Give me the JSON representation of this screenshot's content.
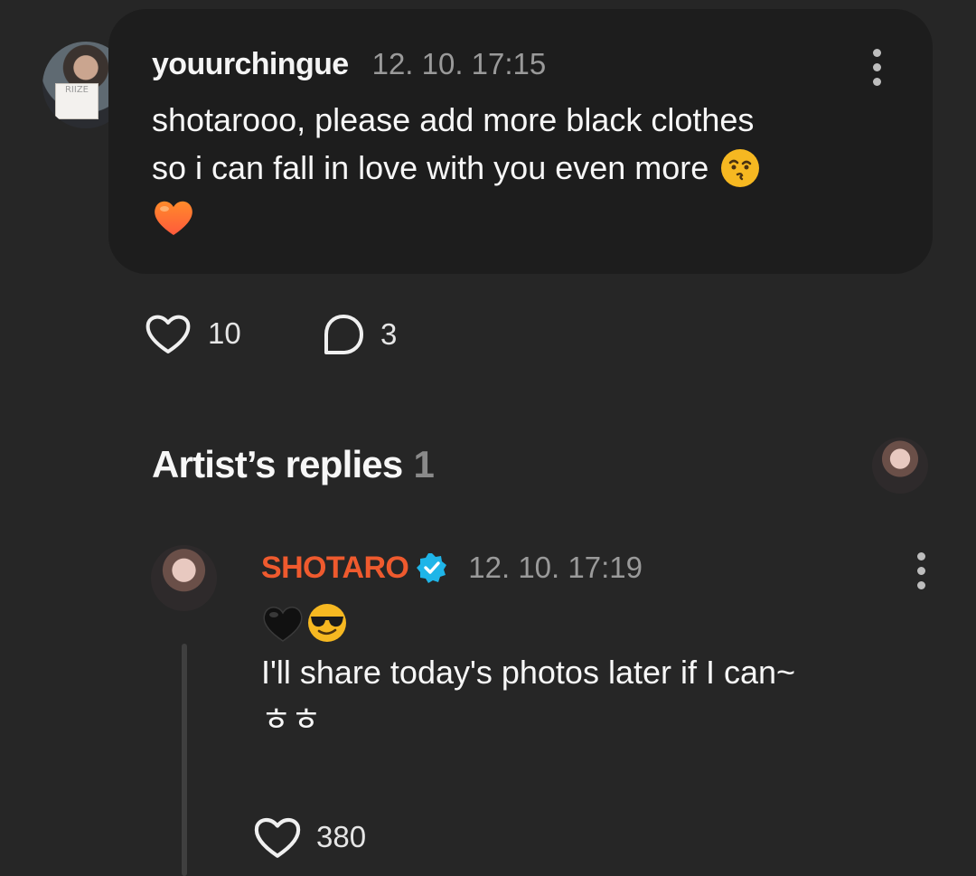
{
  "comment": {
    "username": "youurchingue",
    "timestamp": "12. 10. 17:15",
    "avatar_sign_text": "RIIZE",
    "text_line1": "shotarooo, please add more black clothes",
    "text_line2": "so i can fall in love with you even more",
    "emoji_1": "kissing-face-icon",
    "emoji_2": "orange-heart-icon",
    "likes": "10",
    "replies": "3"
  },
  "artist_replies": {
    "title": "Artist’s replies",
    "count": "1"
  },
  "reply": {
    "username": "SHOTARO",
    "verified_icon": "verified-badge-icon",
    "timestamp": "12. 10. 17:19",
    "emoji_1": "black-heart-icon",
    "emoji_2": "sunglasses-face-icon",
    "text_line1": "I'll share today's photos later if I can~",
    "text_line2": "ㅎㅎ",
    "likes": "380"
  },
  "colors": {
    "background": "#262626",
    "bubble": "#1d1d1d",
    "artist_name": "#ef5a2e",
    "verified_badge": "#1fb5e8",
    "timestamp": "#9a9a9a"
  }
}
